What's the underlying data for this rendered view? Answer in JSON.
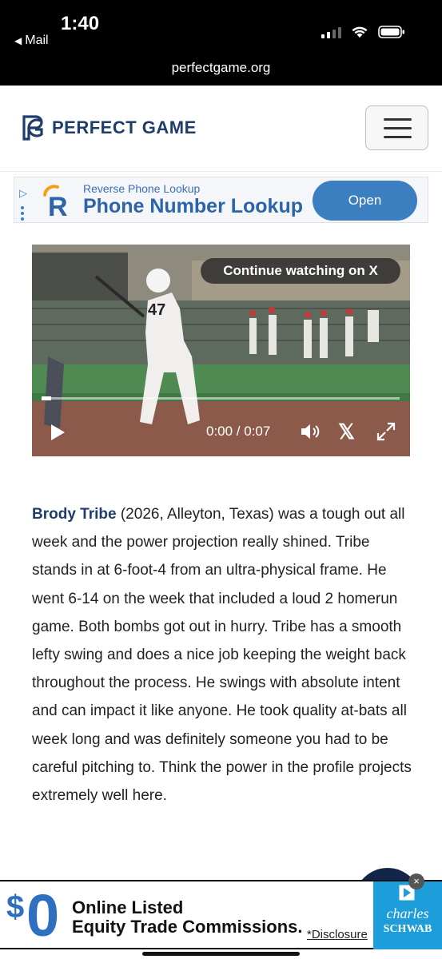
{
  "status_bar": {
    "time": "1:40",
    "back_label": "Mail",
    "url": "perfectgame.org"
  },
  "header": {
    "logo_text": "PERFECT GAME",
    "logo_icon": "pg-monogram-icon",
    "menu_icon": "hamburger-menu-icon",
    "brand_color": "#1e3d6b"
  },
  "top_ad": {
    "small_text": "Reverse Phone Lookup",
    "title": "Phone Number Lookup",
    "button_label": "Open",
    "accent_color": "#3b7fc0"
  },
  "video": {
    "overlay_label": "Continue watching on X",
    "timecode": "0:00 / 0:07",
    "progress": 0,
    "jersey_number": "47",
    "icons": [
      "play-icon",
      "volume-icon",
      "x-logo-icon",
      "fullscreen-icon"
    ]
  },
  "article": {
    "player_name": "Brody Tribe",
    "body": " (2026, Alleyton, Texas) was a tough out all week and the power projection really shined. Tribe stands in at 6-foot-4 from an ultra-physical frame. He went 6-14 on the week that included a loud 2 homerun game. Both bombs got out in hurry. Tribe has a smooth lefty swing and does a nice job keeping the weight back throughout the process. He swings with absolute intent and can impact it like anyone. He took quality at-bats all week long and was definitely someone you had to be careful pitching to. Think the power in the profile projects extremely well here."
  },
  "bottom_ad": {
    "dollar": "$",
    "zero": "0",
    "line1": "Online Listed",
    "line2": "Equity Trade Commissions.",
    "disclosure": "*Disclosure",
    "brand_line1": "charles",
    "brand_line2": "SCHWAB",
    "close_label": "×",
    "brand_color": "#1d9dd9"
  }
}
